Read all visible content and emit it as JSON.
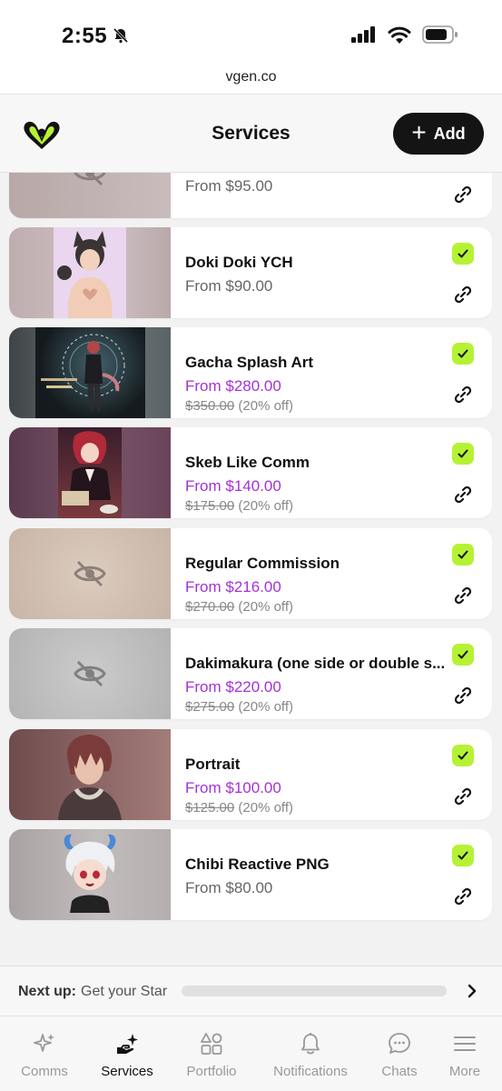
{
  "status_bar": {
    "time": "2:55"
  },
  "browser": {
    "url": "vgen.co"
  },
  "header": {
    "title": "Services",
    "add_label": "Add"
  },
  "services": [
    {
      "title": "",
      "price": "From $95.00",
      "original": "",
      "discount": "",
      "sale": false,
      "active": false,
      "visible": false,
      "thumb": "hidden"
    },
    {
      "title": "Doki Doki YCH",
      "price": "From $90.00",
      "original": "",
      "discount": "",
      "sale": false,
      "active": true,
      "visible": true,
      "thumb": "doki"
    },
    {
      "title": "Gacha Splash Art",
      "price": "From $280.00",
      "original": "$350.00",
      "discount": "(20% off)",
      "sale": true,
      "active": true,
      "visible": true,
      "thumb": "gacha"
    },
    {
      "title": "Skeb Like Comm",
      "price": "From $140.00",
      "original": "$175.00",
      "discount": "(20% off)",
      "sale": true,
      "active": true,
      "visible": true,
      "thumb": "skeb"
    },
    {
      "title": "Regular Commission",
      "price": "From $216.00",
      "original": "$270.00",
      "discount": "(20% off)",
      "sale": true,
      "active": true,
      "visible": false,
      "thumb": "hidden-beige"
    },
    {
      "title": "Dakimakura (one side or double s...",
      "price": "From $220.00",
      "original": "$275.00",
      "discount": "(20% off)",
      "sale": true,
      "active": true,
      "visible": false,
      "thumb": "hidden-gray"
    },
    {
      "title": "Portrait",
      "price": "From $100.00",
      "original": "$125.00",
      "discount": "(20% off)",
      "sale": true,
      "active": true,
      "visible": true,
      "thumb": "portrait"
    },
    {
      "title": "Chibi Reactive PNG",
      "price": "From $80.00",
      "original": "",
      "discount": "",
      "sale": false,
      "active": true,
      "visible": true,
      "thumb": "chibi"
    }
  ],
  "next_up": {
    "label": "Next up:",
    "text": "Get your Star",
    "progress": 0.0
  },
  "tabs": [
    {
      "label": "Comms",
      "icon": "sparkles-icon",
      "active": false
    },
    {
      "label": "Services",
      "icon": "hand-sparkle-icon",
      "active": true
    },
    {
      "label": "Portfolio",
      "icon": "shapes-icon",
      "active": false
    },
    {
      "label": "Notifications",
      "icon": "bell-icon",
      "active": false
    },
    {
      "label": "Chats",
      "icon": "chat-bubble-icon",
      "active": false
    },
    {
      "label": "More",
      "icon": "menu-icon",
      "active": false
    }
  ],
  "colors": {
    "accent_green": "#b6f234",
    "sale_purple": "#a432d6",
    "dark": "#141414"
  }
}
